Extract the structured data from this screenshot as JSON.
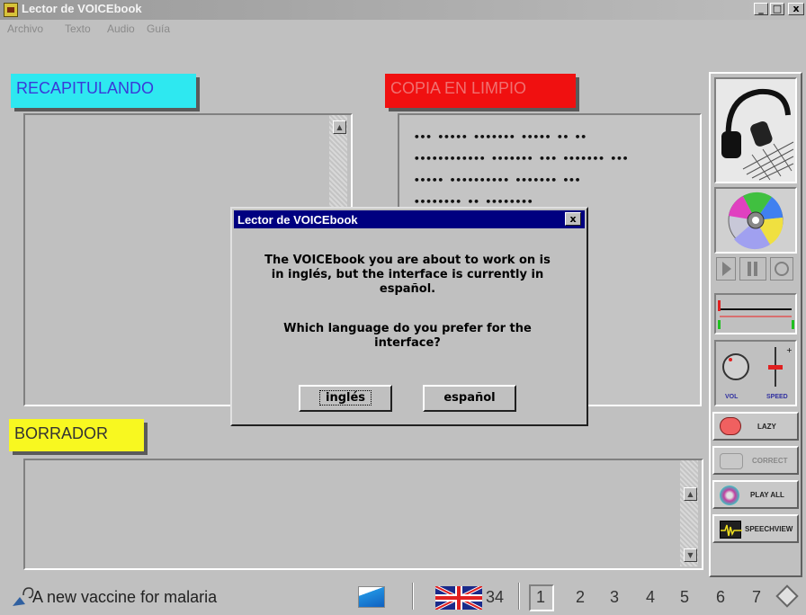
{
  "window": {
    "title": "Lector de VOICEbook",
    "minimize": "_",
    "maximize": "□",
    "close": "x"
  },
  "menu": [
    {
      "label": "Archivo"
    },
    {
      "label": "Texto"
    },
    {
      "label": "Audio"
    },
    {
      "label": "Guía"
    }
  ],
  "sections": {
    "recapitulando": {
      "label": "RECAPITULANDO",
      "color": "#2ee8f0"
    },
    "copia": {
      "label": "COPIA EN LIMPIO",
      "color": "#f01010"
    },
    "borrador": {
      "label": "BORRADOR",
      "color": "#f8f820"
    }
  },
  "copia_lines": [
    "••• ••••• ••••••• ••••• •• ••",
    "•••••••••••• ••••••• ••• ••••••• •••",
    "••••• •••••••••• ••••••• •••",
    "•••••••• •• ••••••••"
  ],
  "right_panel": {
    "vol_label": "VOL",
    "speed_label": "SPEED",
    "buttons": [
      {
        "label": "LAZY"
      },
      {
        "label": "CORRECT"
      },
      {
        "label": "PLAY ALL"
      },
      {
        "label": "SPEECHVIEW"
      }
    ]
  },
  "dialog": {
    "title": "Lector de VOICEbook",
    "close": "x",
    "message": "The VOICEbook you are about to work on is in inglés, but the interface is currently in español.",
    "question": "Which language do you prefer for the interface?",
    "btn_ingles": "inglés",
    "btn_espanol": "español"
  },
  "status": {
    "document_title": "A new vaccine for malaria",
    "page_count": "34",
    "pages": [
      "1",
      "2",
      "3",
      "4",
      "5",
      "6",
      "7"
    ],
    "current_page": "1"
  }
}
